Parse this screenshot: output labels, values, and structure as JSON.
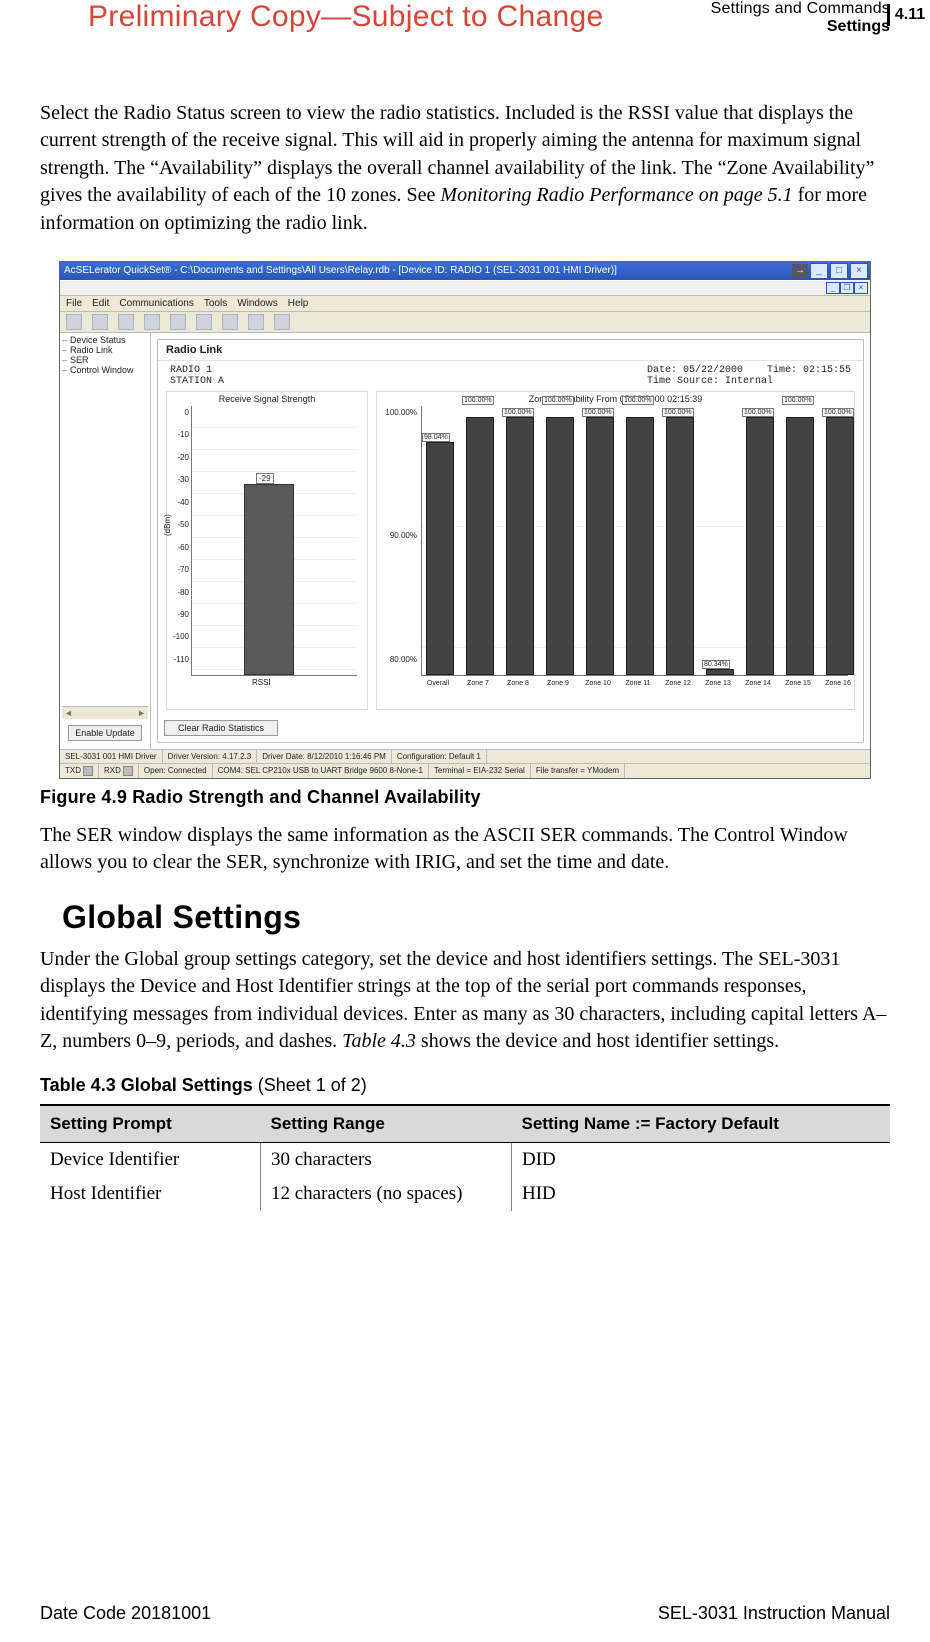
{
  "header": {
    "watermark": "Preliminary Copy—Subject to Change",
    "chapter": "Settings and Commands",
    "section": "Settings",
    "page_num": "4.11"
  },
  "para1_html": "Select the Radio Status screen to view the radio statistics. Included is the RSSI value that displays the current strength of the receive signal. This will aid in properly aiming the antenna for maximum signal strength. The “Availability” displays the overall channel availability of the link. The “Zone Availability” gives the availability of each of the 10 zones. See <em>Monitoring Radio Performance on page 5.1</em> for more information on optimizing the radio link.",
  "figure": {
    "caption": "Figure 4.9    Radio Strength and Channel Availability",
    "app": {
      "title": "AcSELerator QuickSet® - C:\\Documents and Settings\\All Users\\Relay.rdb - [Device ID: RADIO 1 (SEL-3031 001 HMI Driver)]",
      "menu": [
        "File",
        "Edit",
        "Communications",
        "Tools",
        "Windows",
        "Help"
      ],
      "tree": [
        "Device Status",
        "Radio Link",
        "SER",
        "Control Window"
      ],
      "enable_btn": "Enable Update",
      "card_title": "Radio Link",
      "meta": {
        "radio": "RADIO 1",
        "station": "STATION A",
        "date_lbl": "Date: 05/22/2000",
        "time_lbl": "Time: 02:15:55",
        "src": "Time Source: Internal"
      },
      "rssi": {
        "title": "Receive Signal Strength",
        "ylabel": "(dBm)",
        "value": -29,
        "value_str": "-29",
        "xcat": "RSSI"
      },
      "zone": {
        "title": "Zone Availability From  05/22/2000 02:15:39"
      },
      "clear_btn": "Clear Radio Statistics",
      "status": {
        "row1": [
          "SEL-3031 001 HMI Driver",
          "Driver Version: 4.17.2.3",
          "Driver Date: 8/12/2010 1:16:46 PM",
          "Configuration: Default 1"
        ],
        "row2_txd": "TXD",
        "row2_rxd": "RXD",
        "row2": [
          "Open: Connected",
          "COM4: SEL CP210x USB to UART Bridge   9600  8-None-1",
          "Terminal = EIA-232 Serial",
          "File transfer = YModem"
        ]
      }
    }
  },
  "chart_data": [
    {
      "type": "bar",
      "title": "Receive Signal Strength",
      "ylabel": "(dBm)",
      "ylim": [
        -110,
        0
      ],
      "yticks": [
        0,
        -10,
        -20,
        -30,
        -40,
        -50,
        -60,
        -70,
        -80,
        -90,
        -100,
        -110
      ],
      "categories": [
        "RSSI"
      ],
      "values": [
        -29
      ]
    },
    {
      "type": "bar",
      "title": "Zone Availability From  05/22/2000 02:15:39",
      "ylabel": "",
      "ylim": [
        80,
        100
      ],
      "yticks": [
        100.0,
        90.0,
        80.0
      ],
      "categories": [
        "Overall",
        "Zone 7",
        "Zone 8",
        "Zone 9",
        "Zone 10",
        "Zone 11",
        "Zone 12",
        "Zone 13",
        "Zone 14",
        "Zone 15",
        "Zone 16"
      ],
      "values": [
        98.04,
        100.0,
        100.0,
        100.0,
        100.0,
        100.0,
        100.0,
        80.34,
        100.0,
        100.0,
        100.0
      ],
      "value_labels": [
        "98.04%",
        "100.00%",
        "100.00%",
        "100.00%",
        "100.00%",
        "100.00%",
        "100.00%",
        "80.34%",
        "100.00%",
        "100.00%",
        "100.00%"
      ]
    }
  ],
  "para2": "The SER window displays the same information as the ASCII SER commands. The Control Window allows you to clear the SER, synchronize with IRIG, and set the time and date.",
  "section": {
    "title": "Global Settings",
    "para_html": "Under the Global group settings category, set the device and host identifiers settings. The SEL-3031 displays the Device and Host Identifier strings at the top of the serial port commands responses, identifying messages from individual devices. Enter as many as 30 characters, including capital letters A–Z, numbers 0–9, periods, and dashes. <em>Table 4.3</em> shows the device and host identifier settings."
  },
  "table": {
    "caption_bold": "Table 4.3    Global Settings",
    "caption_rest": " (Sheet 1 of 2)",
    "headers": [
      "Setting Prompt",
      "Setting Range",
      "Setting Name := Factory Default"
    ],
    "rows": [
      [
        "Device Identifier",
        "30 characters",
        "DID"
      ],
      [
        "Host Identifier",
        "12 characters (no spaces)",
        "HID"
      ]
    ]
  },
  "footer": {
    "left": "Date Code 20181001",
    "right": "SEL-3031 Instruction Manual"
  }
}
